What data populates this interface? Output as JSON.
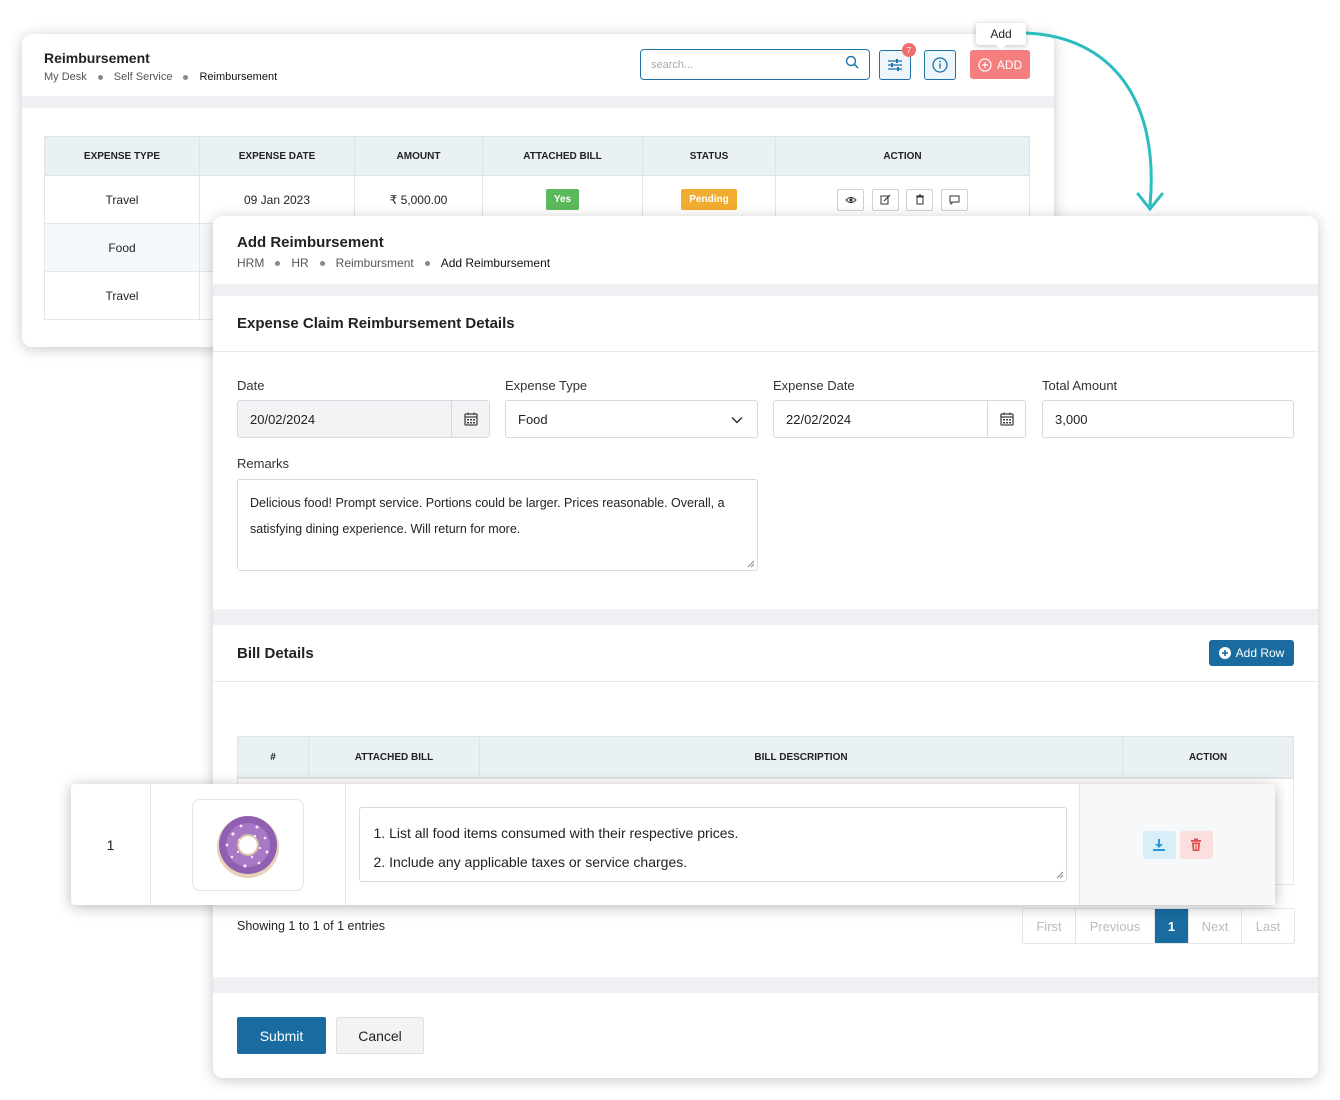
{
  "back": {
    "title": "Reimbursement",
    "breadcrumb": [
      "My Desk",
      "Self Service",
      "Reimbursement"
    ],
    "search_placeholder": "search...",
    "filter_badge": "7",
    "add_label": "ADD",
    "tooltip": "Add",
    "table": {
      "headers": [
        "EXPENSE TYPE",
        "EXPENSE DATE",
        "AMOUNT",
        "ATTACHED BILL",
        "STATUS",
        "ACTION"
      ],
      "rows": [
        {
          "type": "Travel",
          "date": "09 Jan 2023",
          "amount": "₹ 5,000.00",
          "bill": "Yes",
          "status": "Pending"
        },
        {
          "type": "Food"
        },
        {
          "type": "Travel"
        }
      ]
    },
    "colors": {
      "yes": "#5cb85c",
      "pending": "#f0ad32"
    }
  },
  "front": {
    "title": "Add Reimbursement",
    "breadcrumb": [
      "HRM",
      "HR",
      "Reimbursment",
      "Add Reimbursement"
    ],
    "section_title": "Expense Claim Reimbursement Details",
    "fields": {
      "date_label": "Date",
      "date_value": "20/02/2024",
      "type_label": "Expense Type",
      "type_value": "Food",
      "exp_date_label": "Expense Date",
      "exp_date_value": "22/02/2024",
      "total_label": "Total Amount",
      "total_value": "3,000",
      "remarks_label": "Remarks",
      "remarks_value": "Delicious food! Prompt service. Portions could be larger. Prices reasonable. Overall, a satisfying dining experience. Will return for more."
    },
    "bill_title": "Bill Details",
    "add_row_label": "Add Row",
    "bill_headers": [
      "#",
      "ATTACHED BILL",
      "BILL DESCRIPTION",
      "ACTION"
    ],
    "showing": "Showing 1 to 1 of 1 entries",
    "pager": [
      "First",
      "Previous",
      "1",
      "Next",
      "Last"
    ],
    "submit_label": "Submit",
    "cancel_label": "Cancel"
  },
  "row": {
    "index": "1",
    "desc_line1": "1. List all food items consumed with their respective prices.",
    "desc_line2": "2. Include any applicable taxes or service charges."
  },
  "accent": "#1a6ca0"
}
